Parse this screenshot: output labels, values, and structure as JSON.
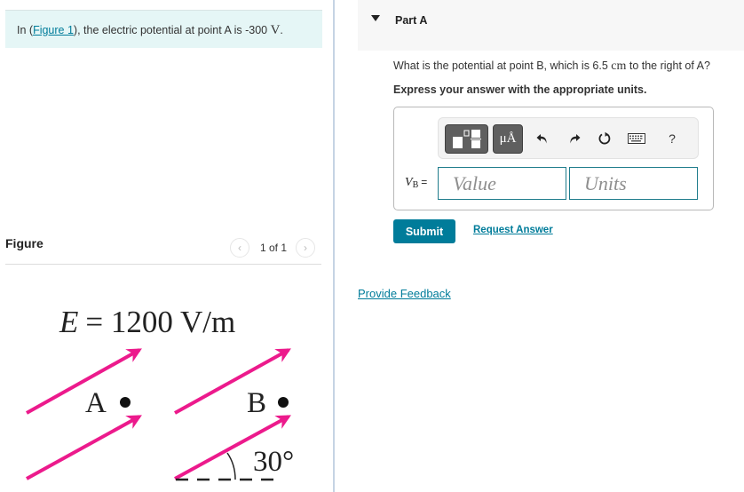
{
  "intro": {
    "prefix": "In (",
    "figure_link": "Figure 1",
    "suffix": "), the electric potential at point A is -300 ",
    "unit": "V",
    "period": "."
  },
  "figure_panel": {
    "title": "Figure",
    "pager_text": "1 of 1",
    "prev_icon": "chevron-left-icon",
    "next_icon": "chevron-right-icon",
    "diagram": {
      "field_label": "E = 1200 V/m",
      "field_symbol": "E",
      "field_value": "= 1200 V/m",
      "point_a": "A",
      "point_b": "B",
      "angle_label": "30°",
      "arrow_color": "#ec1a8c"
    }
  },
  "part": {
    "title": "Part A",
    "question_prefix": "What is the potential at point B, which is 6.5 ",
    "question_unit": "cm",
    "question_suffix": " to the right of A?",
    "instruction": "Express your answer with the appropriate units.",
    "toolbar": {
      "templates_icon": "templates-icon",
      "units_label": "μÅ",
      "undo_icon": "undo-icon",
      "redo_icon": "redo-icon",
      "reset_icon": "reset-icon",
      "keyboard_icon": "keyboard-icon",
      "help_label": "?"
    },
    "answer": {
      "variable": "V",
      "subscript": "B",
      "equals": "=",
      "value_placeholder": "Value",
      "value": "",
      "units_placeholder": "Units",
      "units": ""
    },
    "submit_label": "Submit",
    "request_answer_label": "Request Answer"
  },
  "feedback_label": "Provide Feedback",
  "colors": {
    "accent": "#007c9a",
    "intro_bg": "#e5f6f6",
    "arrow": "#ec1a8c"
  }
}
